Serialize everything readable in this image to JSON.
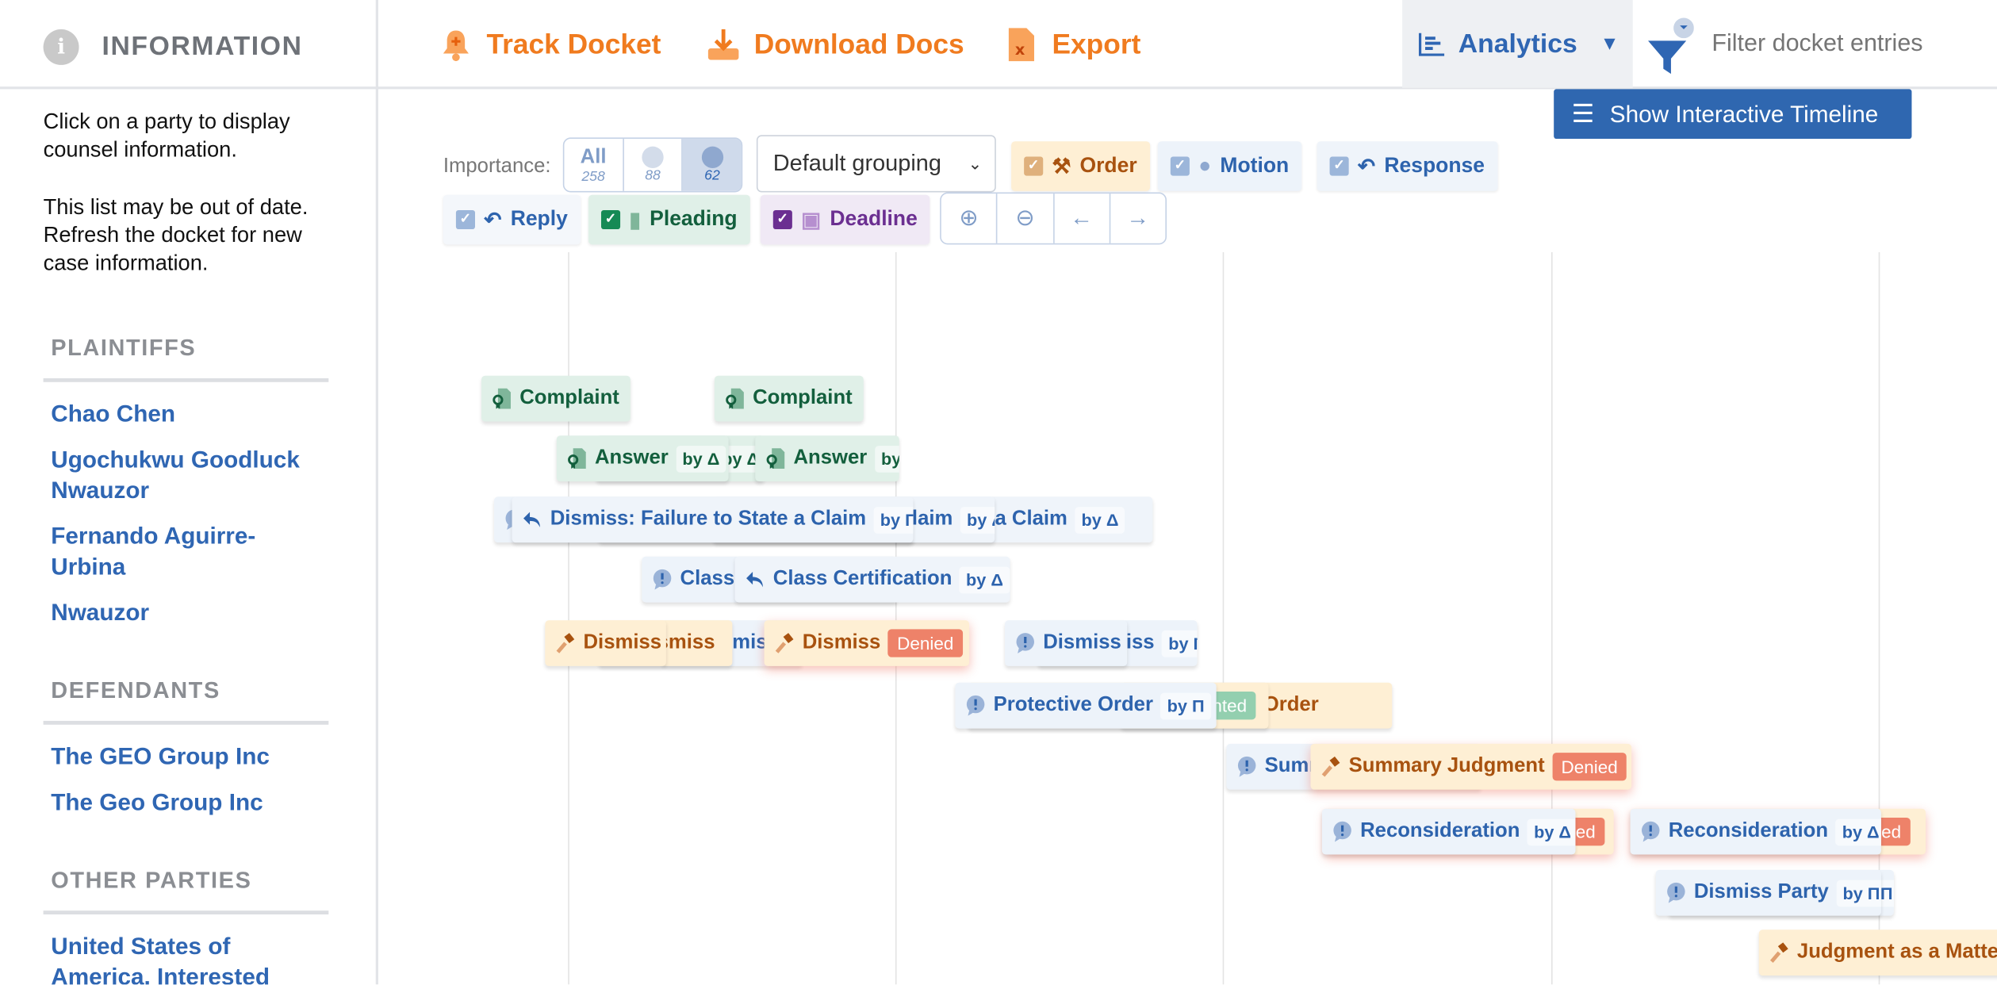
{
  "sidebar": {
    "title": "INFORMATION",
    "intro": "Click on a party to display counsel information.",
    "note": "This list may be out of date. Refresh the docket for new case information.",
    "plaintiffs_heading": "PLAINTIFFS",
    "plaintiffs": [
      "Chao Chen",
      "Ugochukwu Goodluck Nwauzor",
      "Fernando Aguirre-Urbina",
      "Nwauzor"
    ],
    "defendants_heading": "DEFENDANTS",
    "defendants": [
      "The GEO Group Inc",
      "The Geo Group Inc"
    ],
    "other_heading": "OTHER PARTIES",
    "others": [
      "United States of America, Interested"
    ]
  },
  "toolbar": {
    "track": "Track Docket",
    "download": "Download Docs",
    "export": "Export",
    "analytics": "Analytics",
    "filter_placeholder": "Filter docket entries",
    "timeline_button": "Show Interactive Timeline"
  },
  "controls": {
    "importance_label": "Importance:",
    "importance": [
      {
        "label": "All",
        "count": "258"
      },
      {
        "label": "",
        "count": "88"
      },
      {
        "label": "",
        "count": "62",
        "selected": true
      }
    ],
    "grouping": "Default grouping",
    "types": [
      {
        "label": "Order",
        "checked": true,
        "color": "#a8520f"
      },
      {
        "label": "Motion",
        "checked": true,
        "color": "#2d63ad"
      },
      {
        "label": "Response",
        "checked": true,
        "color": "#2d63ad"
      },
      {
        "label": "Reply",
        "checked": true,
        "color": "#2d63ad"
      },
      {
        "label": "Pleading",
        "checked": true,
        "color": "#135f3d"
      },
      {
        "label": "Deadline",
        "checked": true,
        "color": "#6b2f91"
      }
    ],
    "nav_icons": [
      "zoom-in-icon",
      "zoom-out-icon",
      "arrow-left-icon",
      "arrow-right-icon"
    ]
  },
  "colors": {
    "denied": "#ee8269",
    "granted": "#93cfaf",
    "accent": "#f07b1f",
    "link": "#2f66b3"
  },
  "timeline": {
    "entries": [
      {
        "type": "pleading",
        "label": "Complaint"
      },
      {
        "type": "pleading",
        "label": "Complaint"
      },
      {
        "type": "pleading",
        "label": "Answer",
        "party": "by Δ"
      },
      {
        "type": "pleading",
        "label": "Answer",
        "party": "by Δ"
      },
      {
        "type": "pleading",
        "label": "Answer",
        "party": "by Δ"
      },
      {
        "type": "motion",
        "label": "Dismiss: Failure to State a Claim",
        "party": "by Δ"
      },
      {
        "type": "reply",
        "label": "Dismiss: Failure to State a Claim",
        "party": "by Δ"
      },
      {
        "type": "reply",
        "label": "Dismiss: Failure to State a Claim",
        "party": "by Δ"
      },
      {
        "type": "reply",
        "label": "Dismiss: Failure to State a Claim",
        "party": "by Π"
      },
      {
        "type": "motion",
        "label": "Class Certification"
      },
      {
        "type": "reply",
        "label": "Class Certification",
        "party": "by Δ"
      },
      {
        "type": "motion",
        "label": "Dismiss"
      },
      {
        "type": "order",
        "label": "Dismiss"
      },
      {
        "type": "order",
        "label": "Dismiss"
      },
      {
        "type": "order",
        "label": "Dismiss",
        "status": "Denied"
      },
      {
        "type": "motion",
        "label": "Dismiss",
        "party": "by Π"
      },
      {
        "type": "motion",
        "label": "Dismiss"
      },
      {
        "type": "order",
        "label": "Protective Order"
      },
      {
        "type": "order",
        "label": "Protective Order",
        "status": "Granted"
      },
      {
        "type": "motion",
        "label": "Protective Order",
        "party": "by Π"
      },
      {
        "type": "motion",
        "label": "Summary Judgment"
      },
      {
        "type": "order",
        "label": "Summary Judgment",
        "status": "Denied"
      },
      {
        "type": "order",
        "label": "Reconsideration",
        "status": "Denied"
      },
      {
        "type": "motion",
        "label": "Reconsideration",
        "party": "by Δ"
      },
      {
        "type": "order",
        "label": "Reconsideration",
        "status": "Denied"
      },
      {
        "type": "motion",
        "label": "Reconsideration",
        "party": "by Δ"
      },
      {
        "type": "motion",
        "label": "Dismiss Party",
        "party": "by Π"
      },
      {
        "type": "motion",
        "label": "Dismiss Party",
        "party": "by Π"
      },
      {
        "type": "order",
        "label": "Judgment as a Matter"
      }
    ]
  }
}
